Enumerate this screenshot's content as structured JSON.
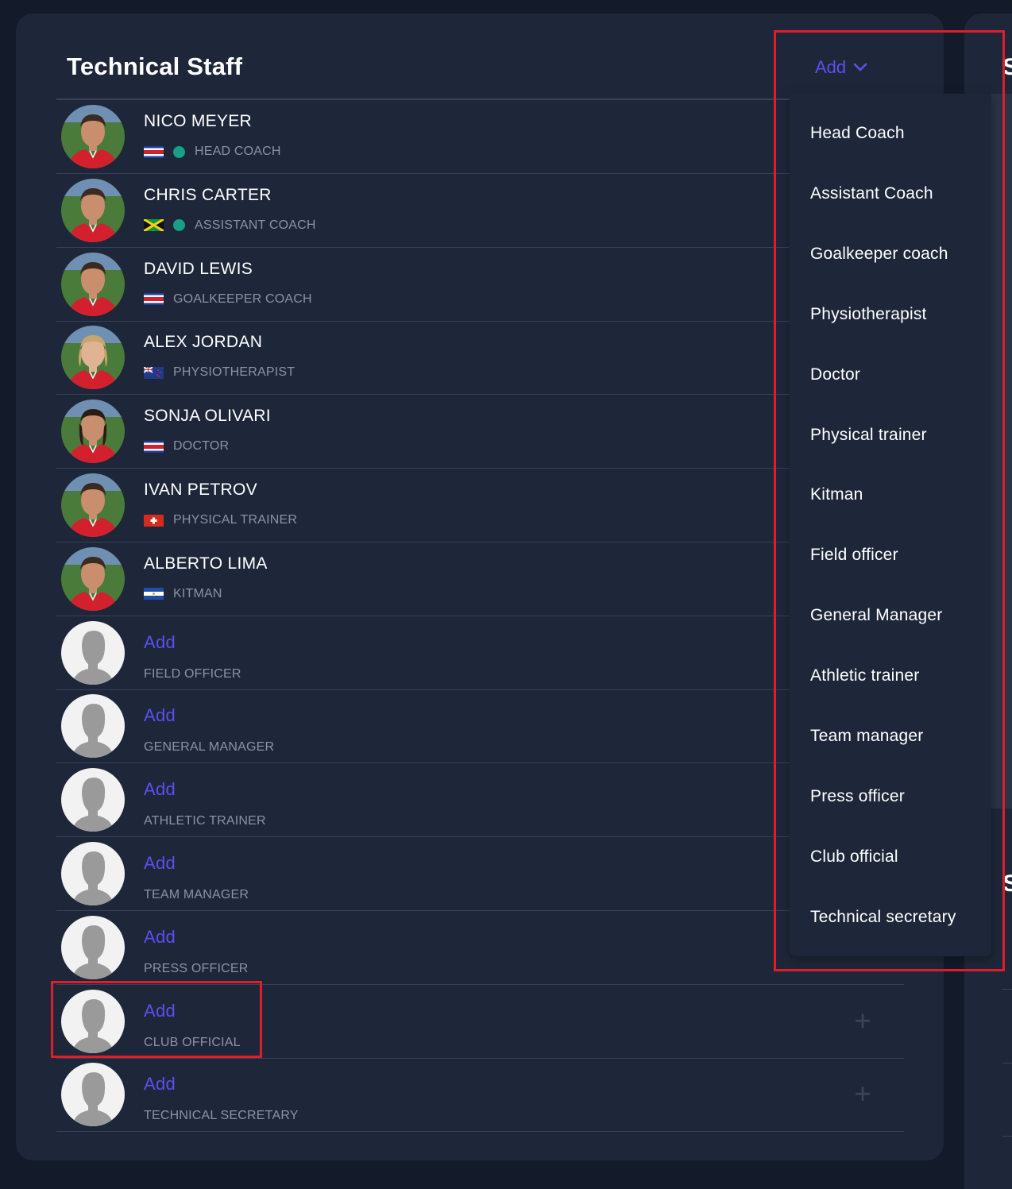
{
  "title": "Technical Staff",
  "add_label": "Add",
  "staff": [
    {
      "name": "NICO MEYER",
      "role": "HEAD COACH",
      "flag": "costa-rica-flag",
      "status_dot": true
    },
    {
      "name": "CHRIS CARTER",
      "role": "ASSISTANT COACH",
      "flag": "jamaica-flag",
      "status_dot": true
    },
    {
      "name": "DAVID LEWIS",
      "role": "GOALKEEPER COACH",
      "flag": "costa-rica-flag",
      "status_dot": false
    },
    {
      "name": "ALEX JORDAN",
      "role": "PHYSIOTHERAPIST",
      "flag": "new-zealand-flag",
      "status_dot": false
    },
    {
      "name": "SONJA OLIVARI",
      "role": "DOCTOR",
      "flag": "costa-rica-flag",
      "status_dot": false
    },
    {
      "name": "IVAN PETROV",
      "role": "PHYSICAL TRAINER",
      "flag": "switzerland-flag",
      "status_dot": false
    },
    {
      "name": "ALBERTO LIMA",
      "role": "KITMAN",
      "flag": "el-salvador-flag",
      "status_dot": false
    }
  ],
  "vacant": [
    {
      "label": "Add",
      "role": "FIELD OFFICER"
    },
    {
      "label": "Add",
      "role": "GENERAL MANAGER"
    },
    {
      "label": "Add",
      "role": "ATHLETIC TRAINER"
    },
    {
      "label": "Add",
      "role": "TEAM MANAGER"
    },
    {
      "label": "Add",
      "role": "PRESS OFFICER"
    },
    {
      "label": "Add",
      "role": "CLUB OFFICIAL"
    },
    {
      "label": "Add",
      "role": "TECHNICAL SECRETARY"
    }
  ],
  "menu": [
    "Head Coach",
    "Assistant Coach",
    "Goalkeeper coach",
    "Physiotherapist",
    "Doctor",
    "Physical trainer",
    "Kitman",
    "Field officer",
    "General Manager",
    "Athletic trainer",
    "Team manager",
    "Press officer",
    "Club official",
    "Technical secretary"
  ],
  "right_panel_letters": [
    "S",
    "S"
  ],
  "colors": {
    "accent": "#5b4ff0",
    "panel": "#1e2739",
    "background": "#131b2b",
    "status_dot": "#17a085",
    "highlight": "#e11d2a"
  }
}
